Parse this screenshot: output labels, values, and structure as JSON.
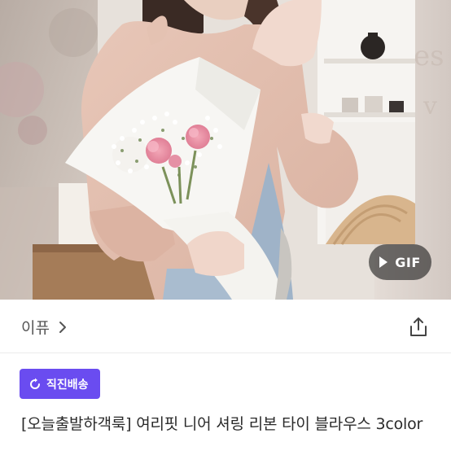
{
  "media": {
    "image_alt": "",
    "gif_label": "GIF"
  },
  "seller": {
    "name": "이퓨"
  },
  "badge": {
    "label": "직진배송",
    "color": "#6a4cf0"
  },
  "product": {
    "title": "[오늘출발하객룩] 여리핏 니어 셔링 리본 타이 블라우스 3color"
  },
  "icons": {
    "gif": "play-icon",
    "seller": "chevron-right-icon",
    "share": "share-icon",
    "badge": "refresh-icon"
  }
}
